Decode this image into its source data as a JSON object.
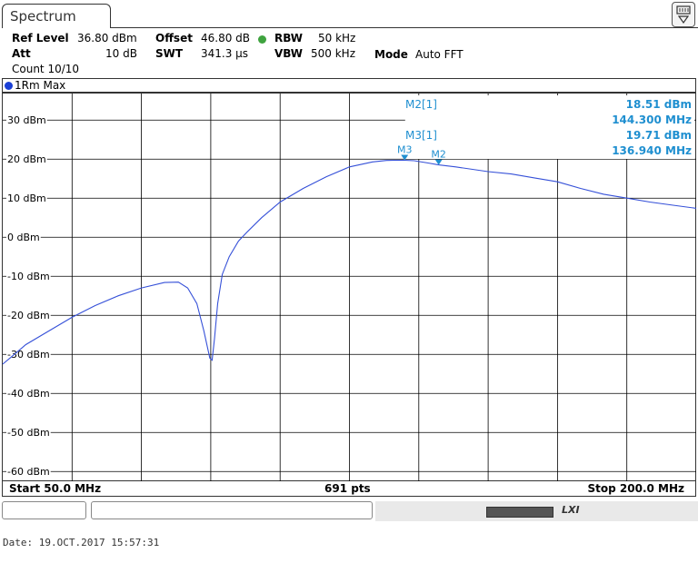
{
  "window": {
    "tab_title": "Spectrum",
    "corner_icon": "display-icon"
  },
  "settings": {
    "ref_level_label": "Ref Level",
    "ref_level_value": "36.80 dBm",
    "offset_label": "Offset",
    "offset_value": "46.80 dB",
    "rbw_label": "RBW",
    "rbw_value": "50 kHz",
    "att_label": "Att",
    "att_value": "10 dB",
    "swt_label": "SWT",
    "swt_value": "341.3 µs",
    "vbw_label": "VBW",
    "vbw_value": "500 kHz",
    "mode_label": "Mode",
    "mode_value": "Auto FFT",
    "count": "Count 10/10"
  },
  "trace_header": {
    "label": "1Rm Max",
    "color": "#1a3fd6"
  },
  "footer": {
    "start": "Start 50.0 MHz",
    "points": "691 pts",
    "stop": "Stop 200.0 MHz"
  },
  "status": {
    "date_line": "Date: 19.OCT.2017  15:57:31"
  },
  "colors": {
    "trace": "#3550d8",
    "marker": "#1f8fd0",
    "grid": "#000000"
  },
  "chart_data": {
    "type": "line",
    "x_unit": "MHz",
    "y_unit": "dBm",
    "xlim": [
      50,
      200
    ],
    "ylim": [
      -62.5,
      36.8
    ],
    "y_ticks": [
      30,
      20,
      10,
      0,
      -10,
      -20,
      -30,
      -40,
      -50,
      -60
    ],
    "y_tick_labels": [
      "30 dBm",
      "20 dBm",
      "10 dBm",
      "0 dBm",
      "-10 dBm",
      "-20 dBm",
      "-30 dBm",
      "-40 dBm",
      "-50 dBm",
      "-60 dBm"
    ],
    "grid": true,
    "series": [
      {
        "x": [
          50,
          52,
          55,
          60,
          65,
          70,
          75,
          80,
          85,
          88,
          90,
          92,
          93.5,
          94.8,
          95.3,
          95.8,
          96.5,
          97.5,
          99,
          101,
          103,
          106,
          110,
          115,
          120,
          125,
          130,
          133,
          135,
          136.94,
          139,
          142,
          144.3,
          148,
          155,
          160,
          165,
          170,
          175,
          180,
          185,
          190,
          195,
          200
        ],
        "y": [
          -32.5,
          -30.5,
          -27.5,
          -24,
          -20.5,
          -17.5,
          -15,
          -13,
          -11.6,
          -11.5,
          -13,
          -17,
          -24,
          -31,
          -31.5,
          -26,
          -17,
          -9.5,
          -5,
          -1,
          1.5,
          5,
          9,
          12.5,
          15.5,
          18,
          19.3,
          19.65,
          19.7,
          19.71,
          19.6,
          19,
          18.51,
          18,
          16.8,
          16.2,
          15.2,
          14.2,
          12.5,
          11,
          10,
          9,
          8.2,
          7.4
        ]
      }
    ],
    "markers": [
      {
        "id": "M3",
        "label": "M3",
        "readout": "M3[1]",
        "x": 136.94,
        "y": 19.71,
        "level": "19.71 dBm",
        "freq": "136.940 MHz"
      },
      {
        "id": "M2",
        "label": "M2",
        "readout": "M2[1]",
        "x": 144.3,
        "y": 18.51,
        "level": "18.51 dBm",
        "freq": "144.300 MHz"
      }
    ],
    "threshold_y": 30
  }
}
